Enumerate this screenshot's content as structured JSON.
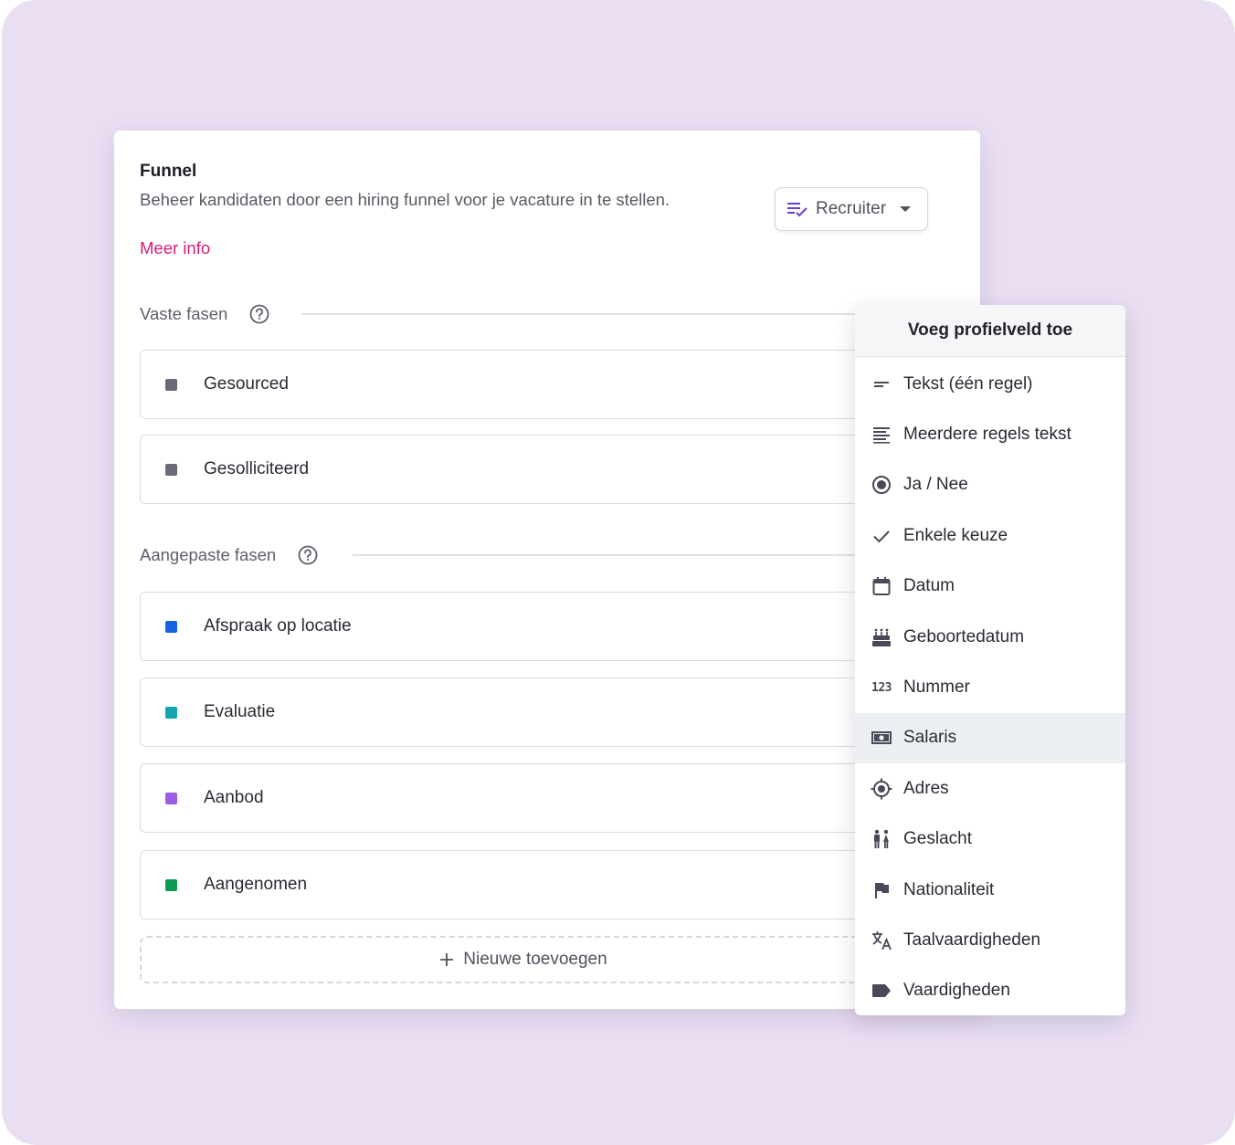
{
  "funnel": {
    "title": "Funnel",
    "description": "Beheer kandidaten door een hiring funnel voor je vacature in te stellen.",
    "more_info": "Meer info",
    "role_button": {
      "label": "Recruiter",
      "icon": "list-check-icon"
    }
  },
  "fixed_stages": {
    "label": "Vaste fasen",
    "items": [
      {
        "name": "Gesourced",
        "color": "#6b6a78"
      },
      {
        "name": "Gesolliciteerd",
        "color": "#6b6a78"
      }
    ]
  },
  "custom_stages": {
    "label": "Aangepaste fasen",
    "items": [
      {
        "name": "Afspraak op locatie",
        "color": "#1463e0"
      },
      {
        "name": "Evaluatie",
        "color": "#12a5ad"
      },
      {
        "name": "Aanbod",
        "color": "#9b5de5"
      },
      {
        "name": "Aangenomen",
        "color": "#0e9a55"
      }
    ]
  },
  "add_new": {
    "label": "Nieuwe toevoegen"
  },
  "dropdown": {
    "title": "Voeg profielveld toe",
    "highlighted": "Salaris",
    "items": [
      {
        "label": "Tekst (één regel)",
        "icon": "short-text-icon"
      },
      {
        "label": "Meerdere regels tekst",
        "icon": "multiline-text-icon"
      },
      {
        "label": "Ja / Nee",
        "icon": "radio-button-icon"
      },
      {
        "label": "Enkele keuze",
        "icon": "check-icon"
      },
      {
        "label": "Datum",
        "icon": "calendar-icon"
      },
      {
        "label": "Geboortedatum",
        "icon": "birthday-cake-icon"
      },
      {
        "label": "Nummer",
        "icon": "numbers-icon",
        "glyph": "123"
      },
      {
        "label": "Salaris",
        "icon": "money-icon"
      },
      {
        "label": "Adres",
        "icon": "location-target-icon"
      },
      {
        "label": "Geslacht",
        "icon": "gender-icon"
      },
      {
        "label": "Nationaliteit",
        "icon": "flag-icon"
      },
      {
        "label": "Taalvaardigheden",
        "icon": "translate-icon"
      },
      {
        "label": "Vaardigheden",
        "icon": "label-tag-icon"
      }
    ]
  }
}
